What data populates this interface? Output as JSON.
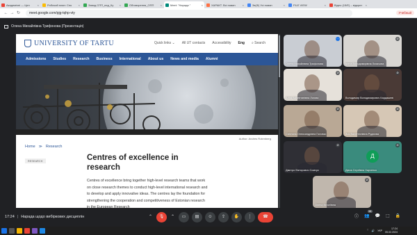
{
  "browser": {
    "tabs": [
      {
        "label": "Академічні — Цен",
        "color": "#ea4335",
        "active": false
      },
      {
        "label": "Робочий план: Спо",
        "color": "#fbbc04",
        "active": false
      },
      {
        "label": "Завод СПП_пед_Ку",
        "color": "#34a853",
        "active": false
      },
      {
        "label": "Обговорення_ОПП",
        "color": "#34a853",
        "active": false
      },
      {
        "label": "Meet: \"Нарада \"",
        "color": "#00897b",
        "active": true
      },
      {
        "label": "ХАРАКТ. Всі новин",
        "color": "#ff7043",
        "active": false
      },
      {
        "label": "Зв(Ф) Усі новин",
        "color": "#4285f4",
        "active": false
      },
      {
        "label": "FILE VIEW",
        "color": "#4285f4",
        "active": false
      },
      {
        "label": "Відео (15/Е) – відкрит",
        "color": "#ea4335",
        "active": false
      }
    ],
    "url": "meet.google.com/pjg-tqhp-vty",
    "profile": "Учебный"
  },
  "meet": {
    "presenter_label": "Олена Михайлівна Трифонова (Презентація)",
    "time": "17:24",
    "meeting_title": "Нарада щодо вибіркових дисциплін",
    "people_count": "16",
    "participants": [
      {
        "name": "Олена Михайлівна Трифонова",
        "bg": "#c9cdd3",
        "mic": "blue-dots"
      },
      {
        "name": "Ірина Володимирівна Лихачова",
        "bg": "#d8d6d2",
        "mic": "muted"
      },
      {
        "name": "Алла Валентинівна Логова",
        "bg": "#e6e1da",
        "mic": "muted"
      },
      {
        "name": "Володимир Володимирович Кардашеві",
        "bg": "#4a3a36",
        "mic": "muted"
      },
      {
        "name": "Світлана Олександрівна Головко",
        "bg": "#b9a895",
        "mic": "muted"
      },
      {
        "name": "Зоя Валентинівна Рудюхва",
        "bg": "#d6c7b5",
        "mic": "muted"
      },
      {
        "name": "Дмитро Вікторович Сомчук",
        "bg": "#2f2f35",
        "mic": "muted"
      },
      {
        "name": "Діана Сергіївна Харченко",
        "bg": "#3a8b7d",
        "mic": "muted",
        "letter": "Д"
      },
      {
        "name": "Олена Віталіївна",
        "bg": "#c0b7ad",
        "mic": "muted"
      }
    ]
  },
  "shared_page": {
    "logo_text": "UNIVERSITY OF TARTU",
    "util_links": [
      "Quick links ⌄",
      "All UT contacts",
      "Accessibility",
      "Eng",
      "Search"
    ],
    "nav": [
      "Admissions",
      "Studies",
      "Research",
      "Business",
      "International",
      "About us",
      "News and media",
      "Alumni"
    ],
    "credit": "Author: Andres Rotenberg",
    "breadcrumb": [
      "Home",
      "Research"
    ],
    "tag": "RESEARCH",
    "title": "Centres of excellence in research",
    "body": "Centres of excellence bring together high-level research teams that work on close research themes to conduct high-level international research and to develop and apply innovative ideas. The centres lay the foundation for strengthening the cooperation and competitiveness of Estonian research in the European Research",
    "accent": "#2c5697"
  },
  "taskbar": {
    "lang": "УКР",
    "clock_time": "17:24",
    "clock_date": "05.02.2024"
  }
}
